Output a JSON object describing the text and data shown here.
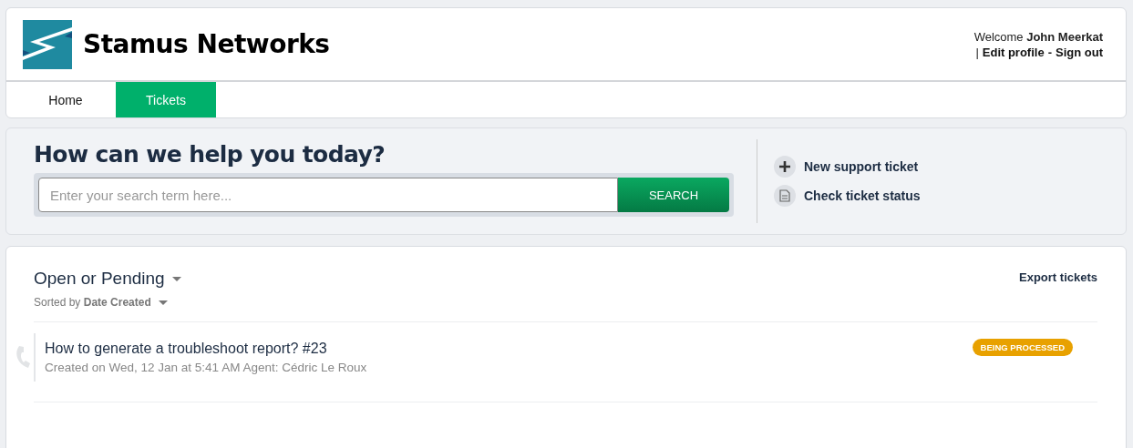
{
  "brand": {
    "name": "Stamus Networks"
  },
  "user": {
    "greeting": "Welcome **John Meerkat**",
    "pipe": "|",
    "links": [
      "Edit profile",
      "Sign out"
    ],
    "dash": "-"
  },
  "nav": [
    {
      "label": "Home",
      "selected": false
    },
    {
      "label": "Tickets",
      "selected": true
    }
  ],
  "hero": {
    "title": "How can we help you today?",
    "search": {
      "placeholder": "Enter your search term here...",
      "button": "SEARCH"
    },
    "actions": [
      {
        "kind": "new",
        "label": "New support ticket"
      },
      {
        "kind": "status",
        "label": "Check ticket status"
      }
    ]
  },
  "tickets": {
    "filter": "Open or Pending",
    "sort_prefix": "Sorted by",
    "sort_field": "Date Created",
    "export": "Export tickets",
    "rows": [
      {
        "title": "How to generate a troubleshoot report? #23",
        "meta": "Created on Wed, 12 Jan at 5:41 AM Agent: Cédric Le Roux",
        "status": "BEING PROCESSED",
        "color": "#e8a100"
      }
    ]
  }
}
